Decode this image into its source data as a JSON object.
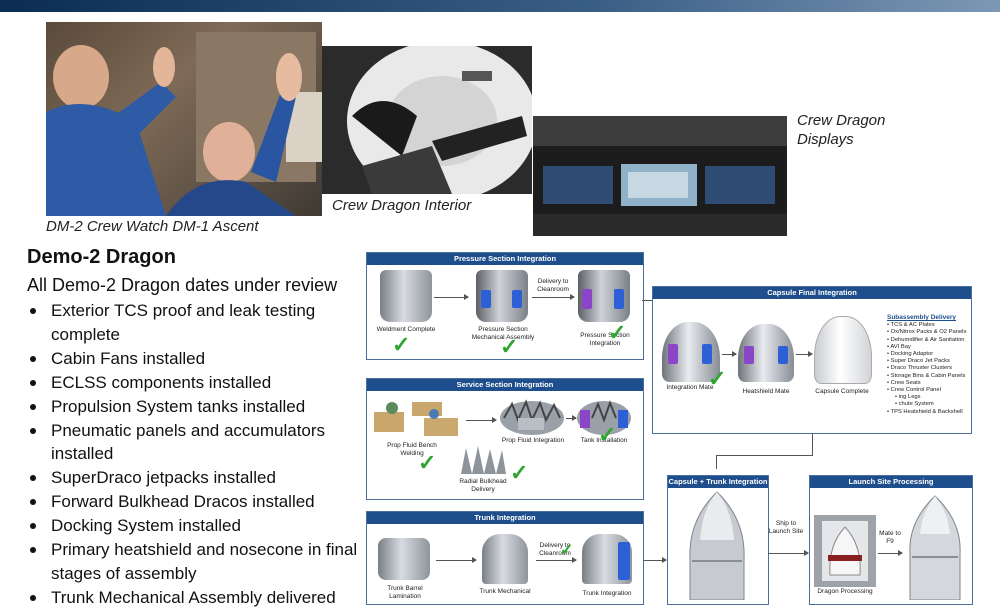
{
  "photos": {
    "crew_watch_caption": "DM-2 Crew Watch DM-1 Ascent",
    "interior_caption": "Crew Dragon Interior",
    "displays_caption_line1": "Crew Dragon",
    "displays_caption_line2": "Displays"
  },
  "left": {
    "title": "Demo-2 Dragon",
    "subtitle": "All Demo-2 Dragon dates under review",
    "bullets": [
      "Exterior TCS proof and leak testing complete",
      "Cabin Fans installed",
      "ECLSS components installed",
      "Propulsion System tanks installed",
      "Pneumatic panels and accumulators installed",
      "SuperDraco jetpacks installed",
      "Forward Bulkhead Dracos installed",
      "Docking System installed",
      "Primary heatshield and nosecone in final stages of assembly",
      "Trunk Mechanical Assembly delivered"
    ]
  },
  "flow": {
    "pressure": {
      "header": "Pressure Section Integration",
      "step1": "Weldment Complete",
      "step2": "Pressure Section Mechanical Assembly",
      "arrow_label": "Delivery to Cleanroom",
      "step3": "Pressure Section Integration"
    },
    "service": {
      "header": "Service Section Integration",
      "step1": "Prop Fluid Bench Welding",
      "step2": "Prop Fluid Integration",
      "step3": "Tank Installation",
      "step4": "Radial Bulkhead Delivery"
    },
    "trunk": {
      "header": "Trunk Integration",
      "step1": "Trunk Barrel Lamination",
      "step2": "Trunk Mechanical",
      "arrow_label": "Delivery to Cleanroom",
      "step3": "Trunk Integration"
    },
    "capsule_final": {
      "header": "Capsule Final Integration",
      "step1": "Integration Mate",
      "step2": "Heatshield Mate",
      "step3": "Capsule Complete",
      "subassembly_title": "Subassembly Delivery",
      "subassembly_items": [
        "TCS & AC Plates",
        "Ox/Nitrox Packs & O2 Panels",
        "Dehumidifier & Air Sanitation",
        "AVI Bay",
        "Docking Adaptor",
        "Super Draco Jet Packs",
        "Draco Thruster Clusters",
        "Storage Bins & Cabin Panels",
        "Crew Seats",
        "Crew Control Panel",
        "ing Legs",
        "chute System",
        "TPS Heatshield & Backshell"
      ]
    },
    "capsule_trunk": {
      "header": "Capsule + Trunk Integration",
      "ship_label": "Ship to Launch Site"
    },
    "launch_site": {
      "header": "Launch Site Processing",
      "step1": "Dragon Processing",
      "mate_label": "Mate to F9"
    }
  },
  "colors": {
    "panel_header": "#1f4e8c",
    "check": "#2ea62e"
  }
}
